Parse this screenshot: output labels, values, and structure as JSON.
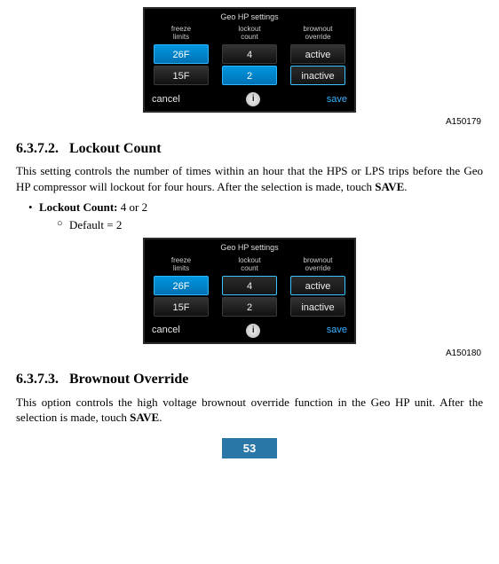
{
  "figure_top": {
    "title": "Geo HP settings",
    "cols": [
      {
        "label": "freeze\nlimits",
        "cells": [
          {
            "val": "26F",
            "style": "selected"
          },
          {
            "val": "15F",
            "style": "plain"
          }
        ]
      },
      {
        "label": "lockout\ncount",
        "cells": [
          {
            "val": "4",
            "style": "plain"
          },
          {
            "val": "2",
            "style": "selected"
          }
        ]
      },
      {
        "label": "brownout\noverride",
        "cells": [
          {
            "val": "active",
            "style": "plain"
          },
          {
            "val": "inactive",
            "style": "highlight"
          }
        ]
      }
    ],
    "cancel": "cancel",
    "save": "save",
    "info": "i",
    "id": "A150179"
  },
  "sec1": {
    "num": "6.3.7.2.",
    "title": "Lockout Count",
    "para": "This setting controls the number of times within an hour that the HPS or LPS trips before the Geo HP compressor will lockout for four hours. After the selection is made, touch ",
    "para_bold": "SAVE",
    "para_end": ".",
    "bullet_bold": "Lockout Count:",
    "bullet_rest": " 4 or 2",
    "sub_bullet": "Default = 2"
  },
  "figure_mid": {
    "title": "Geo HP settings",
    "cols": [
      {
        "label": "freeze\nlimits",
        "cells": [
          {
            "val": "26F",
            "style": "selected"
          },
          {
            "val": "15F",
            "style": "plain"
          }
        ]
      },
      {
        "label": "lockout\ncount",
        "cells": [
          {
            "val": "4",
            "style": "highlight"
          },
          {
            "val": "2",
            "style": "plain"
          }
        ]
      },
      {
        "label": "brownout\noverride",
        "cells": [
          {
            "val": "active",
            "style": "highlight"
          },
          {
            "val": "inactive",
            "style": "plain"
          }
        ]
      }
    ],
    "cancel": "cancel",
    "save": "save",
    "info": "i",
    "id": "A150180"
  },
  "sec2": {
    "num": "6.3.7.3.",
    "title": "Brownout Override",
    "para": "This option controls the high voltage brownout override function in the Geo HP unit. After the selection is made, touch ",
    "para_bold": "SAVE",
    "para_end": "."
  },
  "page": "53"
}
